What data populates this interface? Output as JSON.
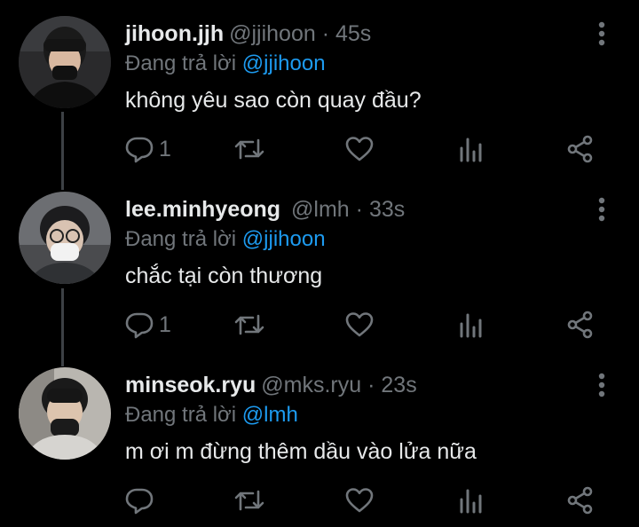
{
  "colors": {
    "background": "#000000",
    "text": "#e7e9ea",
    "muted": "#71767b",
    "link": "#1d9bf0",
    "thread_line": "#3d4145"
  },
  "tweets": [
    {
      "name": "jihoon.jjh",
      "handle": "@jjihoon",
      "separator": "·",
      "time": "45s",
      "reply_prefix": "Đang trả lời",
      "reply_to": "@jjihoon",
      "text": "không yêu sao còn quay đầu?",
      "reply_count": "1",
      "icons": [
        "reply-icon",
        "retweet-icon",
        "like-icon",
        "analytics-icon",
        "share-icon",
        "more-icon"
      ]
    },
    {
      "name": "lee.minhyeong",
      "handle": "@lmh",
      "separator": "·",
      "time": "33s",
      "reply_prefix": "Đang trả lời",
      "reply_to": "@jjihoon",
      "text": "chắc tại còn thương",
      "reply_count": "1",
      "icons": [
        "reply-icon",
        "retweet-icon",
        "like-icon",
        "analytics-icon",
        "share-icon",
        "more-icon"
      ]
    },
    {
      "name": "minseok.ryu",
      "handle": "@mks.ryu",
      "separator": "·",
      "time": "23s",
      "reply_prefix": "Đang trả lời",
      "reply_to": "@lmh",
      "text": "m ơi m đừng thêm dầu vào lửa nữa",
      "reply_count": "",
      "icons": [
        "reply-icon",
        "retweet-icon",
        "like-icon",
        "analytics-icon",
        "share-icon",
        "more-icon"
      ]
    }
  ]
}
